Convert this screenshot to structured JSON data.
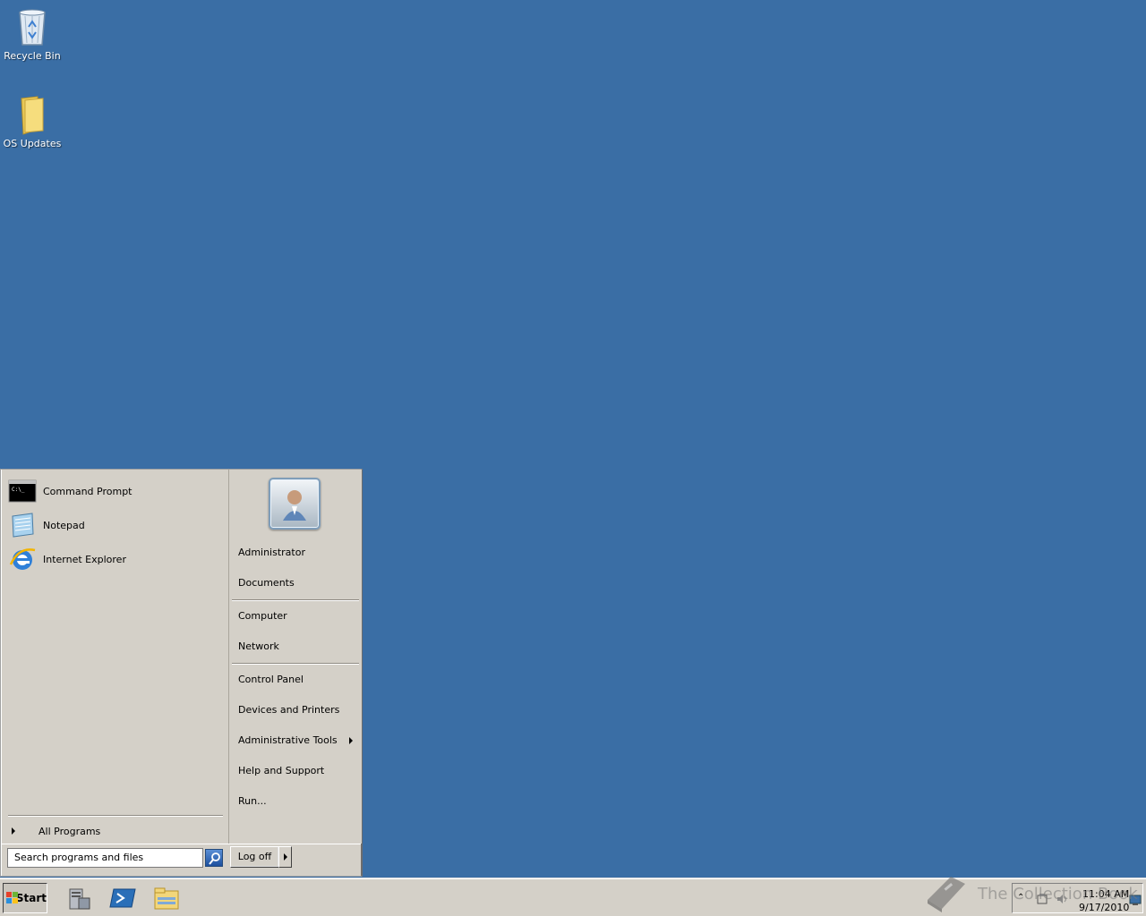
{
  "desktop": {
    "background_color": "#3a6ea5",
    "icons": [
      {
        "label": "Recycle Bin",
        "icon": "recycle-bin-icon"
      },
      {
        "label": "OS Updates",
        "icon": "folder-icon"
      }
    ]
  },
  "start_menu": {
    "pinned_programs": [
      {
        "label": "Command Prompt",
        "icon": "command-prompt-icon"
      },
      {
        "label": "Notepad",
        "icon": "notepad-icon"
      },
      {
        "label": "Internet Explorer",
        "icon": "internet-explorer-icon"
      }
    ],
    "all_programs_label": "All Programs",
    "search_placeholder": "Search programs and files",
    "right_items": [
      {
        "label": "Administrator"
      },
      {
        "label": "Documents"
      },
      {
        "label": "Computer"
      },
      {
        "label": "Network"
      },
      {
        "label": "Control Panel"
      },
      {
        "label": "Devices and Printers"
      },
      {
        "label": "Administrative Tools"
      },
      {
        "label": "Help and Support"
      },
      {
        "label": "Run..."
      }
    ],
    "logoff_label": "Log off"
  },
  "taskbar": {
    "start_label": "Start",
    "quick_launch": [
      {
        "icon": "server-manager-icon"
      },
      {
        "icon": "powershell-icon"
      },
      {
        "icon": "windows-explorer-icon"
      }
    ],
    "watermark": "The Collection Book",
    "clock_time": "11:04 AM",
    "clock_date": "9/17/2010"
  }
}
